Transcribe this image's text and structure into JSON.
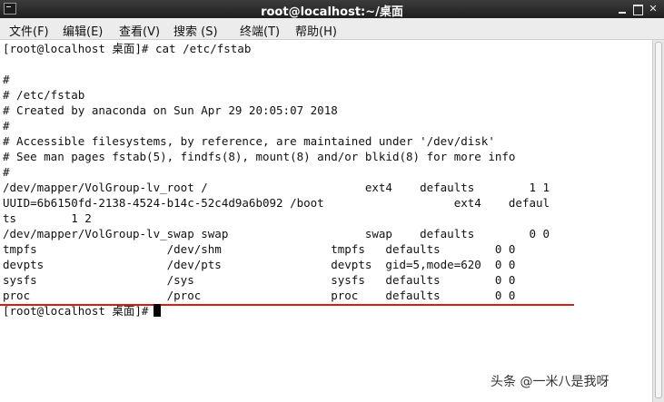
{
  "window": {
    "title": "root@localhost:~/桌面",
    "icon": "terminal-icon",
    "buttons": [
      "minimize-icon",
      "maximize-icon",
      "close-icon"
    ],
    "close_glyph": "✕"
  },
  "menu": {
    "items": [
      {
        "label": "文件(F)"
      },
      {
        "label": "编辑(E)"
      },
      {
        "label": "查看(V)"
      },
      {
        "label": "搜索 (S)"
      },
      {
        "label": "终端(T)"
      },
      {
        "label": "帮助(H)"
      }
    ]
  },
  "terminal": {
    "lines": [
      "[root@localhost 桌面]# cat /etc/fstab",
      "",
      "#",
      "# /etc/fstab",
      "# Created by anaconda on Sun Apr 29 20:05:07 2018",
      "#",
      "# Accessible filesystems, by reference, are maintained under '/dev/disk'",
      "# See man pages fstab(5), findfs(8), mount(8) and/or blkid(8) for more info",
      "#",
      "/dev/mapper/VolGroup-lv_root /                       ext4    defaults        1 1",
      "UUID=6b6150fd-2138-4524-b14c-52c4d9a6b092 /boot                   ext4    defaul",
      "ts        1 2",
      "/dev/mapper/VolGroup-lv_swap swap                    swap    defaults        0 0",
      "tmpfs                   /dev/shm                tmpfs   defaults        0 0",
      "devpts                  /dev/pts                devpts  gid=5,mode=620  0 0",
      "sysfs                   /sys                    sysfs   defaults        0 0",
      "proc                    /proc                   proc    defaults        0 0"
    ],
    "prompt": "[root@localhost 桌面]#"
  },
  "watermark": {
    "text": "头条 @一米八是我呀"
  },
  "colors": {
    "titlebar": "#2a2a2a",
    "menubar": "#ececec",
    "annotation_underline": "#d81a1a"
  }
}
